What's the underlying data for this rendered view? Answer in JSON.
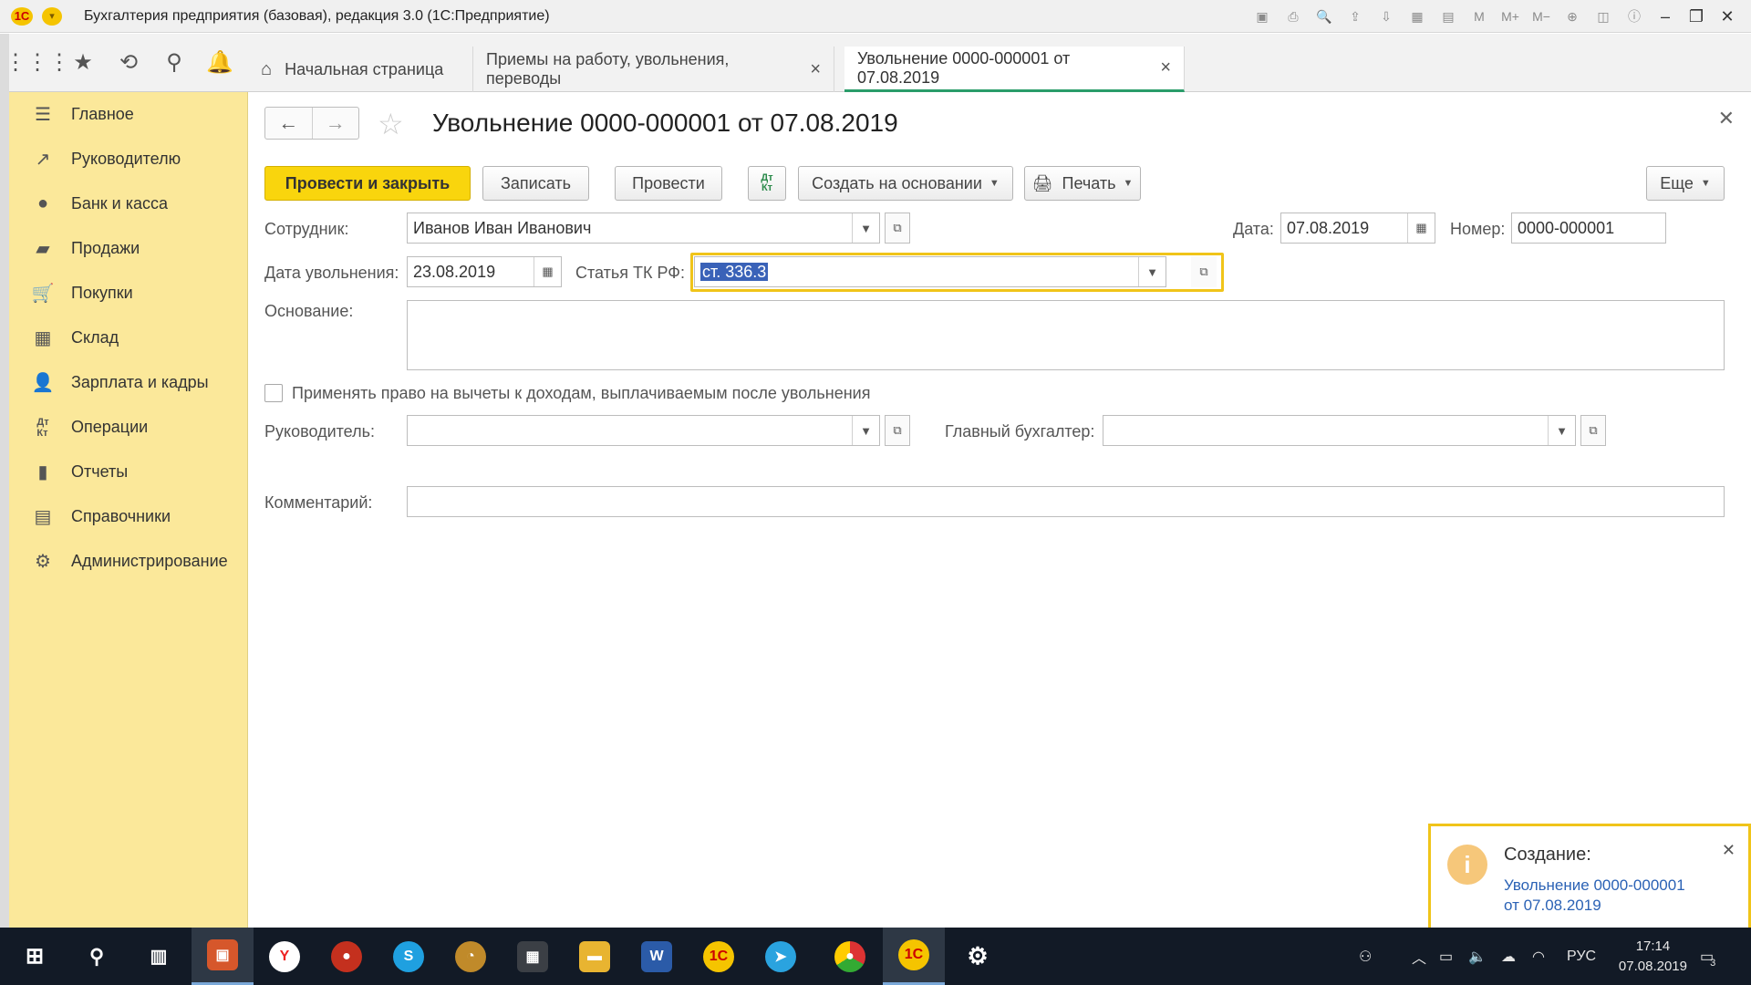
{
  "window": {
    "title": "Бухгалтерия предприятия (базовая), редакция 3.0  (1С:Предприятие)",
    "logo": "1С"
  },
  "tabs": [
    {
      "label": "Начальная страница",
      "closable": false,
      "active": false
    },
    {
      "label": "Приемы на работу, увольнения, переводы",
      "closable": true,
      "active": false
    },
    {
      "label": "Увольнение 0000-000001 от 07.08.2019",
      "closable": true,
      "active": true
    }
  ],
  "sidebar": {
    "items": [
      {
        "label": "Главное",
        "icon": "menu-lines-icon"
      },
      {
        "label": "Руководителю",
        "icon": "trend-up-icon"
      },
      {
        "label": "Банк и касса",
        "icon": "coin-icon"
      },
      {
        "label": "Продажи",
        "icon": "shopping-bag-icon"
      },
      {
        "label": "Покупки",
        "icon": "cart-icon"
      },
      {
        "label": "Склад",
        "icon": "warehouse-grid-icon"
      },
      {
        "label": "Зарплата и кадры",
        "icon": "person-icon"
      },
      {
        "label": "Операции",
        "icon": "dt-kt-icon"
      },
      {
        "label": "Отчеты",
        "icon": "bar-chart-icon"
      },
      {
        "label": "Справочники",
        "icon": "books-icon"
      },
      {
        "label": "Администрирование",
        "icon": "gear-icon"
      }
    ]
  },
  "doc": {
    "title": "Увольнение 0000-000001 от 07.08.2019"
  },
  "actions": {
    "post_close": "Провести и закрыть",
    "save": "Записать",
    "post": "Провести",
    "dtkt": "Дт Кт",
    "create_based": "Создать на основании",
    "print": "Печать",
    "more": "Еще"
  },
  "form": {
    "employee_label": "Сотрудник:",
    "employee_value": "Иванов Иван Иванович",
    "date_label": "Дата:",
    "date_value": "07.08.2019",
    "number_label": "Номер:",
    "number_value": "0000-000001",
    "dismissal_date_label": "Дата увольнения:",
    "dismissal_date_value": "23.08.2019",
    "article_label": "Статья ТК РФ:",
    "article_value": "ст. 336.3",
    "reason_label": "Основание:",
    "reason_value": "",
    "deductions_checkbox_label": "Применять право на вычеты к доходам, выплачиваемым после увольнения",
    "deductions_checked": false,
    "manager_label": "Руководитель:",
    "manager_value": "",
    "chief_accountant_label": "Главный бухгалтер:",
    "chief_accountant_value": "",
    "comment_label": "Комментарий:",
    "comment_value": ""
  },
  "notification": {
    "title": "Создание:",
    "link_line1": "Увольнение 0000-000001",
    "link_line2": "от 07.08.2019"
  },
  "taskbar": {
    "lang": "РУС",
    "time": "17:14",
    "date": "07.08.2019",
    "notifications_count": "3"
  },
  "colors": {
    "accent_yellow": "#f9d50d",
    "sidebar_bg": "#fbe89a",
    "active_tab_underline": "#2a9d6a",
    "link_blue": "#2b62b5",
    "taskbar_bg": "#121a26"
  }
}
